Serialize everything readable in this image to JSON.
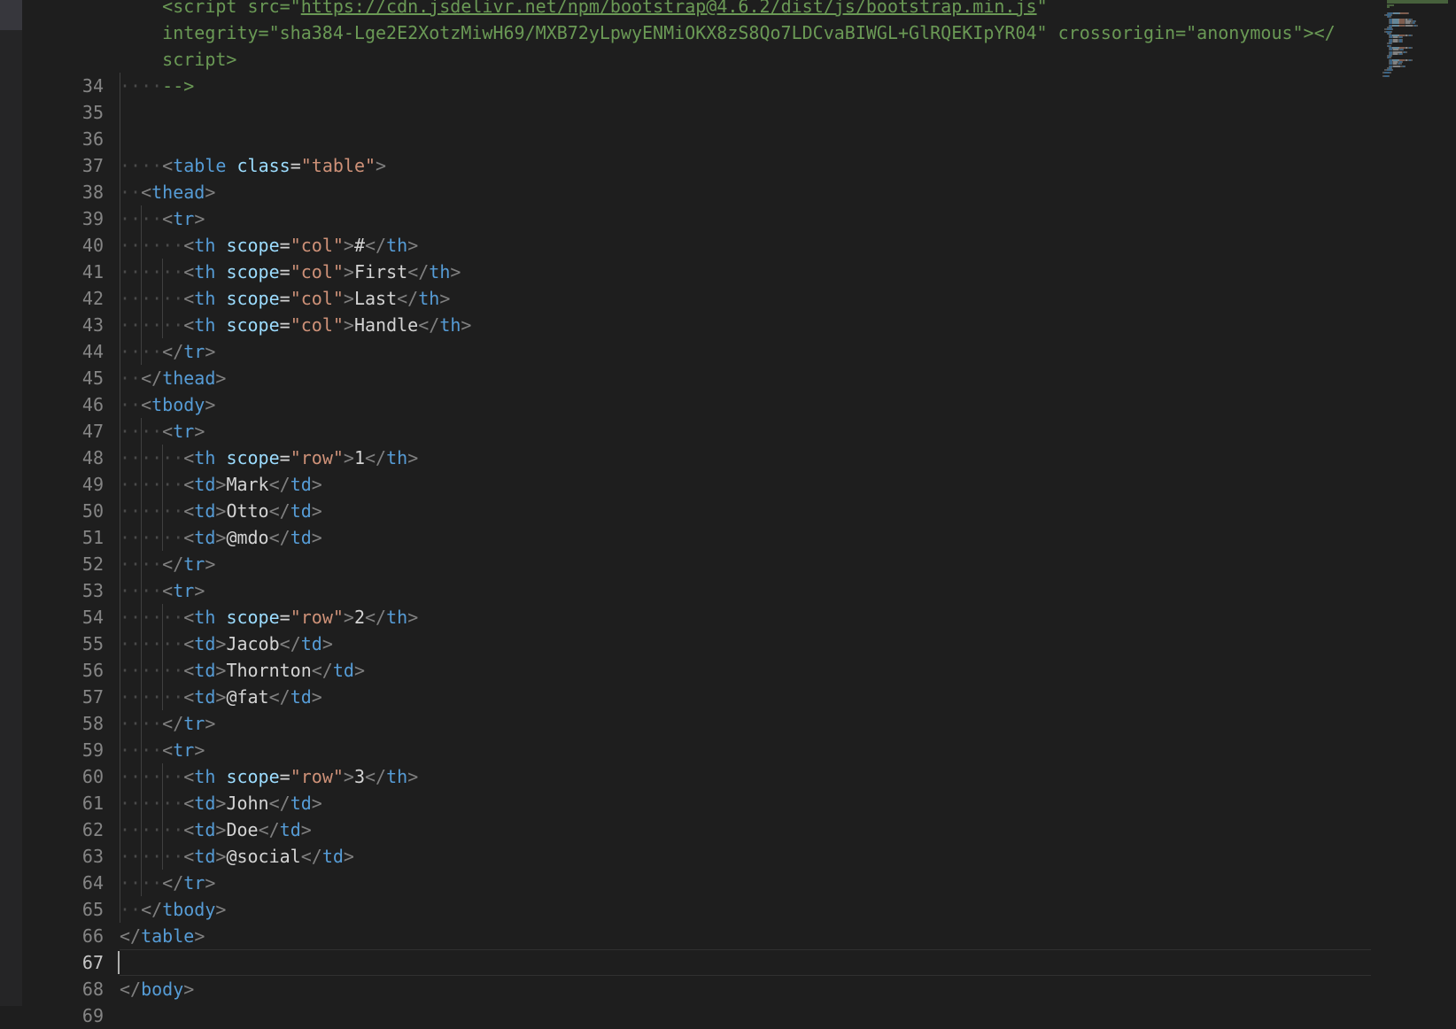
{
  "editor": {
    "active_line": "67",
    "lines": [
      {
        "n": "",
        "indent": "    ",
        "tokens": [
          [
            "c",
            "<script src=\""
          ],
          [
            "cu",
            "https://cdn.jsdelivr.net/npm/bootstrap@4.6.2/dist/js/bootstrap.min.js"
          ],
          [
            "c",
            "\""
          ]
        ]
      },
      {
        "n": "",
        "indent": "    ",
        "tokens": [
          [
            "c",
            "integrity=\"sha384-Lge2E2XotzMiwH69/MXB72yLpwyENMiOKX8zS8Qo7LDCvaBIWGL+GlRQEKIpYR04\" crossorigin=\"anonymous\"></"
          ]
        ]
      },
      {
        "n": "",
        "indent": "    ",
        "tokens": [
          [
            "c",
            "script>"
          ]
        ]
      },
      {
        "n": "34",
        "indent": "····",
        "tokens": [
          [
            "c",
            "-->"
          ]
        ]
      },
      {
        "n": "35",
        "indent": "",
        "tokens": []
      },
      {
        "n": "36",
        "indent": "",
        "tokens": []
      },
      {
        "n": "37",
        "indent": "····",
        "tokens": [
          [
            "p",
            "<"
          ],
          [
            "t",
            "table"
          ],
          [
            "x",
            " "
          ],
          [
            "a",
            "class"
          ],
          [
            "x",
            "="
          ],
          [
            "s",
            "\"table\""
          ],
          [
            "p",
            ">"
          ]
        ]
      },
      {
        "n": "38",
        "indent": "··",
        "tokens": [
          [
            "p",
            "<"
          ],
          [
            "t",
            "thead"
          ],
          [
            "p",
            ">"
          ]
        ]
      },
      {
        "n": "39",
        "indent": "····",
        "tokens": [
          [
            "p",
            "<"
          ],
          [
            "t",
            "tr"
          ],
          [
            "p",
            ">"
          ]
        ]
      },
      {
        "n": "40",
        "indent": "······",
        "tokens": [
          [
            "p",
            "<"
          ],
          [
            "t",
            "th"
          ],
          [
            "x",
            " "
          ],
          [
            "a",
            "scope"
          ],
          [
            "x",
            "="
          ],
          [
            "s",
            "\"col\""
          ],
          [
            "p",
            ">"
          ],
          [
            "x",
            "#"
          ],
          [
            "p",
            "</"
          ],
          [
            "t",
            "th"
          ],
          [
            "p",
            ">"
          ]
        ]
      },
      {
        "n": "41",
        "indent": "······",
        "tokens": [
          [
            "p",
            "<"
          ],
          [
            "t",
            "th"
          ],
          [
            "x",
            " "
          ],
          [
            "a",
            "scope"
          ],
          [
            "x",
            "="
          ],
          [
            "s",
            "\"col\""
          ],
          [
            "p",
            ">"
          ],
          [
            "x",
            "First"
          ],
          [
            "p",
            "</"
          ],
          [
            "t",
            "th"
          ],
          [
            "p",
            ">"
          ]
        ]
      },
      {
        "n": "42",
        "indent": "······",
        "tokens": [
          [
            "p",
            "<"
          ],
          [
            "t",
            "th"
          ],
          [
            "x",
            " "
          ],
          [
            "a",
            "scope"
          ],
          [
            "x",
            "="
          ],
          [
            "s",
            "\"col\""
          ],
          [
            "p",
            ">"
          ],
          [
            "x",
            "Last"
          ],
          [
            "p",
            "</"
          ],
          [
            "t",
            "th"
          ],
          [
            "p",
            ">"
          ]
        ]
      },
      {
        "n": "43",
        "indent": "······",
        "tokens": [
          [
            "p",
            "<"
          ],
          [
            "t",
            "th"
          ],
          [
            "x",
            " "
          ],
          [
            "a",
            "scope"
          ],
          [
            "x",
            "="
          ],
          [
            "s",
            "\"col\""
          ],
          [
            "p",
            ">"
          ],
          [
            "x",
            "Handle"
          ],
          [
            "p",
            "</"
          ],
          [
            "t",
            "th"
          ],
          [
            "p",
            ">"
          ]
        ]
      },
      {
        "n": "44",
        "indent": "····",
        "tokens": [
          [
            "p",
            "</"
          ],
          [
            "t",
            "tr"
          ],
          [
            "p",
            ">"
          ]
        ]
      },
      {
        "n": "45",
        "indent": "··",
        "tokens": [
          [
            "p",
            "</"
          ],
          [
            "t",
            "thead"
          ],
          [
            "p",
            ">"
          ]
        ]
      },
      {
        "n": "46",
        "indent": "··",
        "tokens": [
          [
            "p",
            "<"
          ],
          [
            "t",
            "tbody"
          ],
          [
            "p",
            ">"
          ]
        ]
      },
      {
        "n": "47",
        "indent": "····",
        "tokens": [
          [
            "p",
            "<"
          ],
          [
            "t",
            "tr"
          ],
          [
            "p",
            ">"
          ]
        ]
      },
      {
        "n": "48",
        "indent": "······",
        "tokens": [
          [
            "p",
            "<"
          ],
          [
            "t",
            "th"
          ],
          [
            "x",
            " "
          ],
          [
            "a",
            "scope"
          ],
          [
            "x",
            "="
          ],
          [
            "s",
            "\"row\""
          ],
          [
            "p",
            ">"
          ],
          [
            "x",
            "1"
          ],
          [
            "p",
            "</"
          ],
          [
            "t",
            "th"
          ],
          [
            "p",
            ">"
          ]
        ]
      },
      {
        "n": "49",
        "indent": "······",
        "tokens": [
          [
            "p",
            "<"
          ],
          [
            "t",
            "td"
          ],
          [
            "p",
            ">"
          ],
          [
            "x",
            "Mark"
          ],
          [
            "p",
            "</"
          ],
          [
            "t",
            "td"
          ],
          [
            "p",
            ">"
          ]
        ]
      },
      {
        "n": "50",
        "indent": "······",
        "tokens": [
          [
            "p",
            "<"
          ],
          [
            "t",
            "td"
          ],
          [
            "p",
            ">"
          ],
          [
            "x",
            "Otto"
          ],
          [
            "p",
            "</"
          ],
          [
            "t",
            "td"
          ],
          [
            "p",
            ">"
          ]
        ]
      },
      {
        "n": "51",
        "indent": "······",
        "tokens": [
          [
            "p",
            "<"
          ],
          [
            "t",
            "td"
          ],
          [
            "p",
            ">"
          ],
          [
            "x",
            "@mdo"
          ],
          [
            "p",
            "</"
          ],
          [
            "t",
            "td"
          ],
          [
            "p",
            ">"
          ]
        ]
      },
      {
        "n": "52",
        "indent": "····",
        "tokens": [
          [
            "p",
            "</"
          ],
          [
            "t",
            "tr"
          ],
          [
            "p",
            ">"
          ]
        ]
      },
      {
        "n": "53",
        "indent": "····",
        "tokens": [
          [
            "p",
            "<"
          ],
          [
            "t",
            "tr"
          ],
          [
            "p",
            ">"
          ]
        ]
      },
      {
        "n": "54",
        "indent": "······",
        "tokens": [
          [
            "p",
            "<"
          ],
          [
            "t",
            "th"
          ],
          [
            "x",
            " "
          ],
          [
            "a",
            "scope"
          ],
          [
            "x",
            "="
          ],
          [
            "s",
            "\"row\""
          ],
          [
            "p",
            ">"
          ],
          [
            "x",
            "2"
          ],
          [
            "p",
            "</"
          ],
          [
            "t",
            "th"
          ],
          [
            "p",
            ">"
          ]
        ]
      },
      {
        "n": "55",
        "indent": "······",
        "tokens": [
          [
            "p",
            "<"
          ],
          [
            "t",
            "td"
          ],
          [
            "p",
            ">"
          ],
          [
            "x",
            "Jacob"
          ],
          [
            "p",
            "</"
          ],
          [
            "t",
            "td"
          ],
          [
            "p",
            ">"
          ]
        ]
      },
      {
        "n": "56",
        "indent": "······",
        "tokens": [
          [
            "p",
            "<"
          ],
          [
            "t",
            "td"
          ],
          [
            "p",
            ">"
          ],
          [
            "x",
            "Thornton"
          ],
          [
            "p",
            "</"
          ],
          [
            "t",
            "td"
          ],
          [
            "p",
            ">"
          ]
        ]
      },
      {
        "n": "57",
        "indent": "······",
        "tokens": [
          [
            "p",
            "<"
          ],
          [
            "t",
            "td"
          ],
          [
            "p",
            ">"
          ],
          [
            "x",
            "@fat"
          ],
          [
            "p",
            "</"
          ],
          [
            "t",
            "td"
          ],
          [
            "p",
            ">"
          ]
        ]
      },
      {
        "n": "58",
        "indent": "····",
        "tokens": [
          [
            "p",
            "</"
          ],
          [
            "t",
            "tr"
          ],
          [
            "p",
            ">"
          ]
        ]
      },
      {
        "n": "59",
        "indent": "····",
        "tokens": [
          [
            "p",
            "<"
          ],
          [
            "t",
            "tr"
          ],
          [
            "p",
            ">"
          ]
        ]
      },
      {
        "n": "60",
        "indent": "······",
        "tokens": [
          [
            "p",
            "<"
          ],
          [
            "t",
            "th"
          ],
          [
            "x",
            " "
          ],
          [
            "a",
            "scope"
          ],
          [
            "x",
            "="
          ],
          [
            "s",
            "\"row\""
          ],
          [
            "p",
            ">"
          ],
          [
            "x",
            "3"
          ],
          [
            "p",
            "</"
          ],
          [
            "t",
            "th"
          ],
          [
            "p",
            ">"
          ]
        ]
      },
      {
        "n": "61",
        "indent": "······",
        "tokens": [
          [
            "p",
            "<"
          ],
          [
            "t",
            "td"
          ],
          [
            "p",
            ">"
          ],
          [
            "x",
            "John"
          ],
          [
            "p",
            "</"
          ],
          [
            "t",
            "td"
          ],
          [
            "p",
            ">"
          ]
        ]
      },
      {
        "n": "62",
        "indent": "······",
        "tokens": [
          [
            "p",
            "<"
          ],
          [
            "t",
            "td"
          ],
          [
            "p",
            ">"
          ],
          [
            "x",
            "Doe"
          ],
          [
            "p",
            "</"
          ],
          [
            "t",
            "td"
          ],
          [
            "p",
            ">"
          ]
        ]
      },
      {
        "n": "63",
        "indent": "······",
        "tokens": [
          [
            "p",
            "<"
          ],
          [
            "t",
            "td"
          ],
          [
            "p",
            ">"
          ],
          [
            "x",
            "@social"
          ],
          [
            "p",
            "</"
          ],
          [
            "t",
            "td"
          ],
          [
            "p",
            ">"
          ]
        ]
      },
      {
        "n": "64",
        "indent": "····",
        "tokens": [
          [
            "p",
            "</"
          ],
          [
            "t",
            "tr"
          ],
          [
            "p",
            ">"
          ]
        ]
      },
      {
        "n": "65",
        "indent": "··",
        "tokens": [
          [
            "p",
            "</"
          ],
          [
            "t",
            "tbody"
          ],
          [
            "p",
            ">"
          ]
        ]
      },
      {
        "n": "66",
        "indent": "",
        "tokens": [
          [
            "p",
            "</"
          ],
          [
            "t",
            "table"
          ],
          [
            "p",
            ">"
          ]
        ]
      },
      {
        "n": "67",
        "indent": "",
        "tokens": []
      },
      {
        "n": "68",
        "indent": "",
        "tokens": [
          [
            "p",
            "</"
          ],
          [
            "t",
            "body"
          ],
          [
            "p",
            ">"
          ]
        ]
      },
      {
        "n": "69",
        "indent": "",
        "tokens": []
      }
    ]
  },
  "colors": {
    "background": "#1e1e1e",
    "line_number": "#858585",
    "tag": "#569cd6",
    "attribute": "#9cdcfe",
    "string": "#ce9178",
    "comment": "#6a9955",
    "punctuation": "#808080",
    "text": "#d4d4d4"
  }
}
